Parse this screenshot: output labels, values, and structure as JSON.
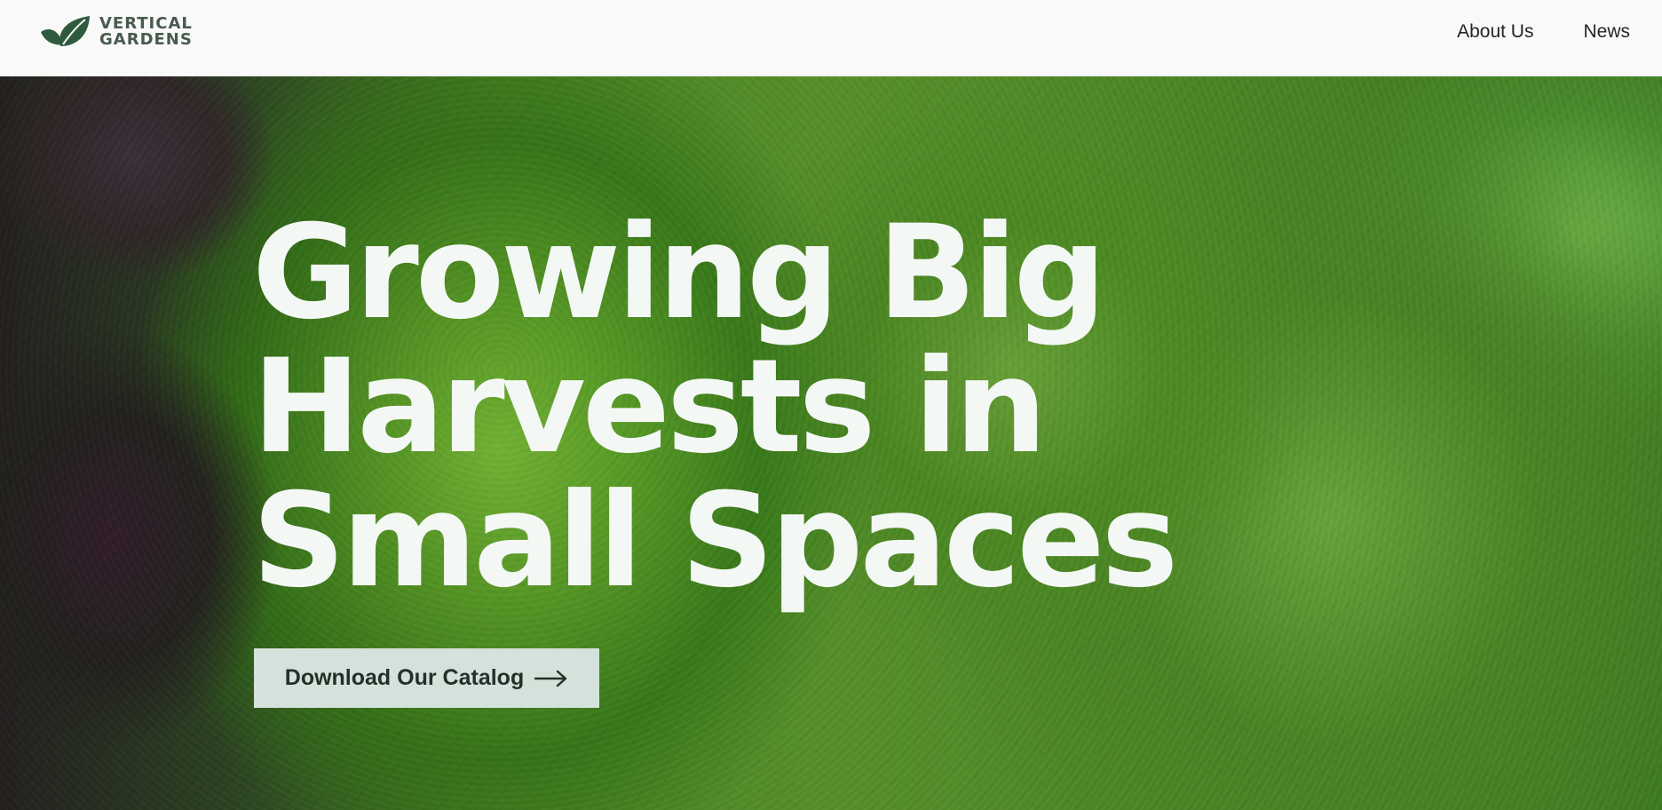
{
  "brand": {
    "line1": "VERTICAL",
    "line2": "GARDENS",
    "icon": "leaf-logo-icon",
    "color": "#2f5a3e"
  },
  "nav": {
    "items": [
      {
        "label": "About Us"
      },
      {
        "label": "News"
      }
    ]
  },
  "hero": {
    "background_image": "vertical-garden-greens-photo",
    "headline_lines": [
      "Growing Big",
      "Harvests in",
      "Small Spaces"
    ],
    "cta_label": "Download Our Catalog",
    "cta_icon": "arrow-right-icon",
    "headline_color": "#f4f8f5",
    "cta_bg": "#d5e2db"
  }
}
